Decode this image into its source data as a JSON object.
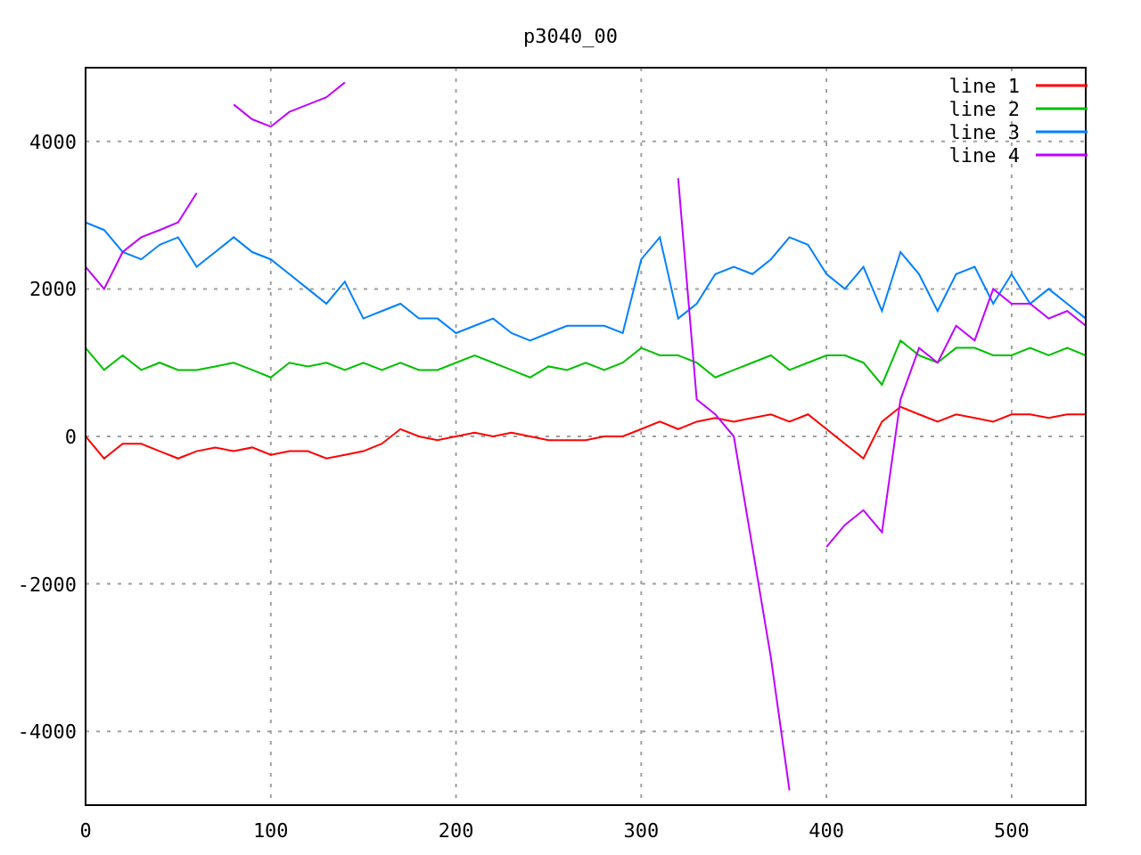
{
  "chart": {
    "chart_data": {
      "type": "line",
      "title": "p3040_00",
      "x": [
        0,
        10,
        20,
        30,
        40,
        50,
        60,
        70,
        80,
        90,
        100,
        110,
        120,
        130,
        140,
        150,
        160,
        170,
        180,
        190,
        200,
        210,
        220,
        230,
        240,
        250,
        260,
        270,
        280,
        290,
        300,
        310,
        320,
        330,
        340,
        350,
        360,
        370,
        380,
        390,
        400,
        410,
        420,
        430,
        440,
        450,
        460,
        470,
        480,
        490,
        500,
        510,
        520,
        530,
        540
      ],
      "grid": true,
      "legend": true,
      "xlim": [
        0,
        540
      ],
      "ylim": [
        -5000,
        5000
      ],
      "xticks": [
        0,
        100,
        200,
        300,
        400,
        500
      ],
      "yticks": [
        -4000,
        -2000,
        0,
        2000,
        4000
      ],
      "series": [
        {
          "name": "line 1",
          "color": "#ff0000",
          "values": [
            0,
            -300,
            -100,
            -100,
            -200,
            -300,
            -200,
            -150,
            -200,
            -150,
            -250,
            -200,
            -200,
            -300,
            -250,
            -200,
            -100,
            100,
            0,
            -50,
            0,
            50,
            0,
            50,
            0,
            -50,
            -50,
            -50,
            0,
            0,
            100,
            200,
            100,
            200,
            250,
            200,
            250,
            300,
            200,
            300,
            100,
            -100,
            -300,
            200,
            400,
            300,
            200,
            300,
            250,
            200,
            300,
            300,
            250,
            300,
            300
          ]
        },
        {
          "name": "line 2",
          "color": "#00c000",
          "values": [
            1200,
            900,
            1100,
            900,
            1000,
            900,
            900,
            950,
            1000,
            900,
            800,
            1000,
            950,
            1000,
            900,
            1000,
            900,
            1000,
            900,
            900,
            1000,
            1100,
            1000,
            900,
            800,
            950,
            900,
            1000,
            900,
            1000,
            1200,
            1100,
            1100,
            1000,
            800,
            900,
            1000,
            1100,
            900,
            1000,
            1100,
            1100,
            1000,
            700,
            1300,
            1100,
            1000,
            1200,
            1200,
            1100,
            1100,
            1200,
            1100,
            1200,
            1100
          ]
        },
        {
          "name": "line 3",
          "color": "#0080ff",
          "values": [
            2900,
            2800,
            2500,
            2400,
            2600,
            2700,
            2300,
            2500,
            2700,
            2500,
            2400,
            2200,
            2000,
            1800,
            2100,
            1600,
            1700,
            1800,
            1600,
            1600,
            1400,
            1500,
            1600,
            1400,
            1300,
            1400,
            1500,
            1500,
            1500,
            1400,
            2400,
            2700,
            1600,
            1800,
            2200,
            2300,
            2200,
            2400,
            2700,
            2600,
            2200,
            2000,
            2300,
            1700,
            2500,
            2200,
            1700,
            2200,
            2300,
            1800,
            2200,
            1800,
            2000,
            1800,
            1600
          ]
        },
        {
          "name": "line 4",
          "color": "#c000ff",
          "values": [
            2300,
            2000,
            2500,
            2700,
            2800,
            2900,
            3300,
            null,
            4500,
            4300,
            4200,
            4400,
            4500,
            4600,
            4800,
            null,
            null,
            null,
            null,
            null,
            null,
            null,
            null,
            null,
            null,
            null,
            null,
            null,
            null,
            null,
            null,
            null,
            3500,
            500,
            300,
            0,
            -1500,
            -3000,
            -4800,
            null,
            -1500,
            -1200,
            -1000,
            -1300,
            500,
            1200,
            1000,
            1500,
            1300,
            2000,
            1800,
            1800,
            1600,
            1700,
            1500
          ]
        }
      ]
    }
  }
}
